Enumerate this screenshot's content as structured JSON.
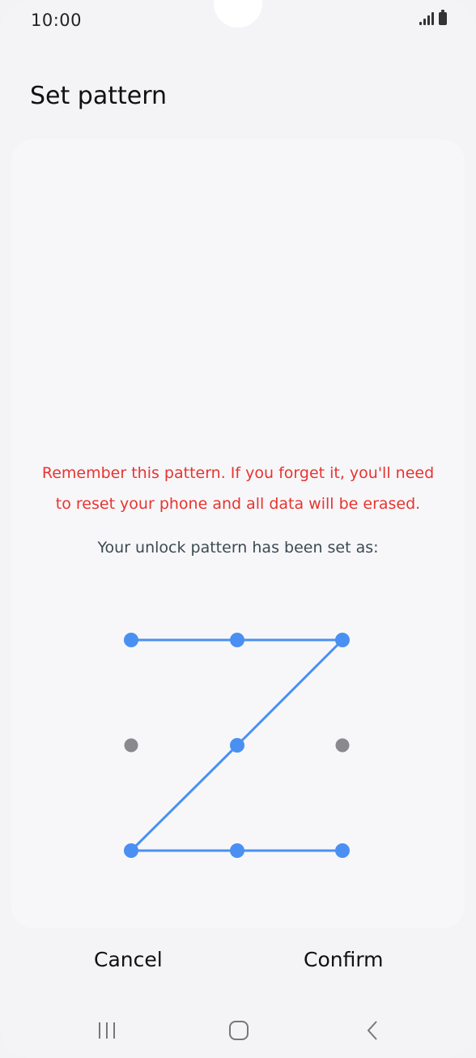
{
  "status_bar": {
    "time": "10:00",
    "icons": [
      "signal-icon",
      "battery-icon"
    ]
  },
  "page": {
    "title": "Set pattern"
  },
  "warning_lines": [
    "Remember this pattern. If you forget it, you'll need",
    "to reset your phone and all data will be erased."
  ],
  "subtext": "Your unlock pattern has been set as:",
  "pattern": {
    "sequence": [
      1,
      2,
      3,
      5,
      7,
      8,
      9
    ],
    "active_color": "#4a90f2",
    "inactive_color": "#8a8a8e"
  },
  "actions": {
    "cancel_label": "Cancel",
    "confirm_label": "Confirm"
  },
  "nav_bar": {
    "items": [
      "recents-icon",
      "home-icon",
      "back-icon"
    ]
  }
}
